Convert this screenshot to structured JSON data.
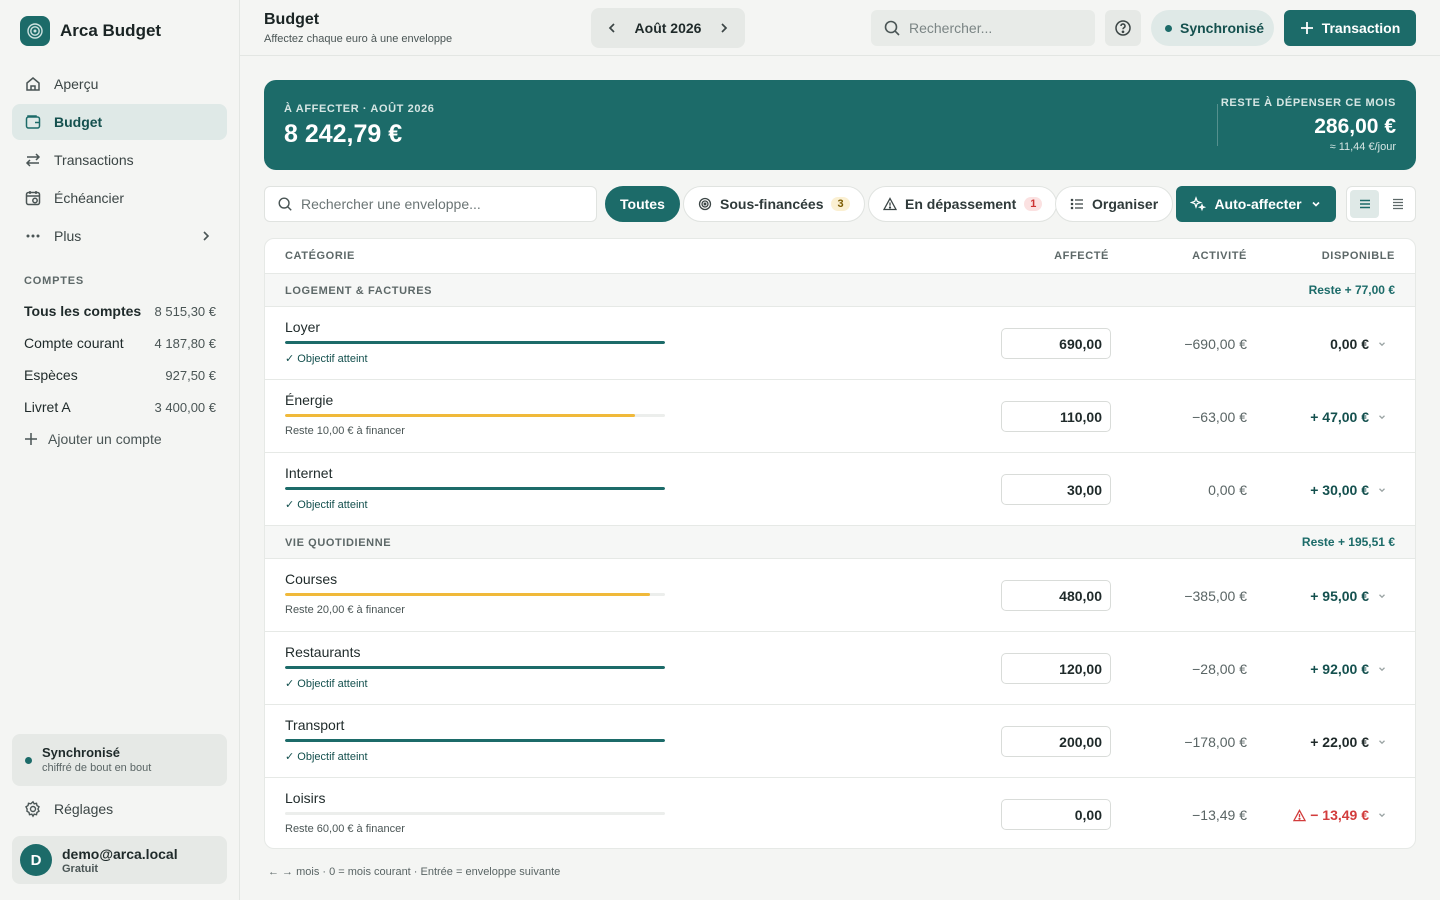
{
  "app": {
    "name": "Arca Budget"
  },
  "nav": [
    {
      "label": "Aperçu",
      "icon": "home-icon"
    },
    {
      "label": "Budget",
      "icon": "wallet-icon"
    },
    {
      "label": "Transactions",
      "icon": "arrows-swap-icon"
    },
    {
      "label": "Échéancier",
      "icon": "calendar-clock-icon"
    },
    {
      "label": "Plus",
      "icon": "more-dots-icon"
    }
  ],
  "accounts": {
    "label": "COMPTES",
    "items": [
      {
        "name": "Tous les comptes",
        "value": "8 515,30 €"
      },
      {
        "name": "Compte courant",
        "value": "4 187,80 €"
      },
      {
        "name": "Espèces",
        "value": "927,50 €"
      },
      {
        "name": "Livret A",
        "value": "3 400,00 €"
      }
    ],
    "add_label": "Ajouter un compte"
  },
  "sync_card": {
    "title": "Synchronisé",
    "subtitle": "chiffré de bout en bout"
  },
  "settings_label": "Réglages",
  "user": {
    "initial": "D",
    "email": "demo@arca.local",
    "plan": "Gratuit"
  },
  "header": {
    "title": "Budget",
    "subtitle": "Affectez chaque euro à une enveloppe",
    "month": "Août 2026",
    "search_placeholder": "Rechercher...",
    "sync_label": "Synchronisé",
    "transaction_label": "Transaction"
  },
  "banner": {
    "label": "À AFFECTER · AOÛT 2026",
    "amount": "8 242,79 €",
    "right_label": "RESTE À DÉPENSER CE MOIS",
    "right_amount": "286,00 €",
    "right_sub": "≈ 11,44 €/jour"
  },
  "toolbar": {
    "search_placeholder": "Rechercher une enveloppe...",
    "chip_all": "Toutes",
    "chip_under": "Sous-financées",
    "chip_under_count": "3",
    "chip_over": "En dépassement",
    "chip_over_count": "1",
    "organize": "Organiser",
    "auto": "Auto-affecter"
  },
  "table": {
    "headers": {
      "category": "CATÉGORIE",
      "assigned": "AFFECTÉ",
      "activity": "ACTIVITÉ",
      "available": "DISPONIBLE"
    },
    "groups": [
      {
        "name": "LOGEMENT & FACTURES",
        "rest": "Reste + 77,00 €",
        "rows": [
          {
            "name": "Loyer",
            "progress": 100,
            "color": "#1c6b69",
            "note": "✓ Objectif atteint",
            "ok": true,
            "assigned": "690,00",
            "activity": "−690,00 €",
            "available": "0,00 €",
            "status": "zero"
          },
          {
            "name": "Énergie",
            "progress": 92,
            "color": "#f0b93a",
            "note": "Reste 10,00 € à financer",
            "ok": false,
            "assigned": "110,00",
            "activity": "−63,00 €",
            "available": "+ 47,00 €",
            "status": "pos"
          },
          {
            "name": "Internet",
            "progress": 100,
            "color": "#1c6b69",
            "note": "✓ Objectif atteint",
            "ok": true,
            "assigned": "30,00",
            "activity": "0,00 €",
            "available": "+ 30,00 €",
            "status": "pos"
          }
        ]
      },
      {
        "name": "VIE QUOTIDIENNE",
        "rest": "Reste + 195,51 €",
        "rows": [
          {
            "name": "Courses",
            "progress": 96,
            "color": "#f0b93a",
            "note": "Reste 20,00 € à financer",
            "ok": false,
            "assigned": "480,00",
            "activity": "−385,00 €",
            "available": "+ 95,00 €",
            "status": "pos"
          },
          {
            "name": "Restaurants",
            "progress": 100,
            "color": "#1c6b69",
            "note": "✓ Objectif atteint",
            "ok": true,
            "assigned": "120,00",
            "activity": "−28,00 €",
            "available": "+ 92,00 €",
            "status": "pos"
          },
          {
            "name": "Transport",
            "progress": 100,
            "color": "#1c6b69",
            "note": "✓ Objectif atteint",
            "ok": true,
            "assigned": "200,00",
            "activity": "−178,00 €",
            "available": "+ 22,00 €",
            "status": "dark"
          },
          {
            "name": "Loisirs",
            "progress": 0,
            "color": "#1c6b69",
            "note": "Reste 60,00 € à financer",
            "ok": false,
            "assigned": "0,00",
            "activity": "−13,49 €",
            "available": "− 13,49 €",
            "status": "neg"
          }
        ]
      }
    ]
  },
  "footer_hint": "← → mois · 0 = mois courant · Entrée = enveloppe suivante",
  "colors": {
    "accent": "#1c6b69",
    "warning": "#f0b93a",
    "danger": "#d23c3c"
  }
}
